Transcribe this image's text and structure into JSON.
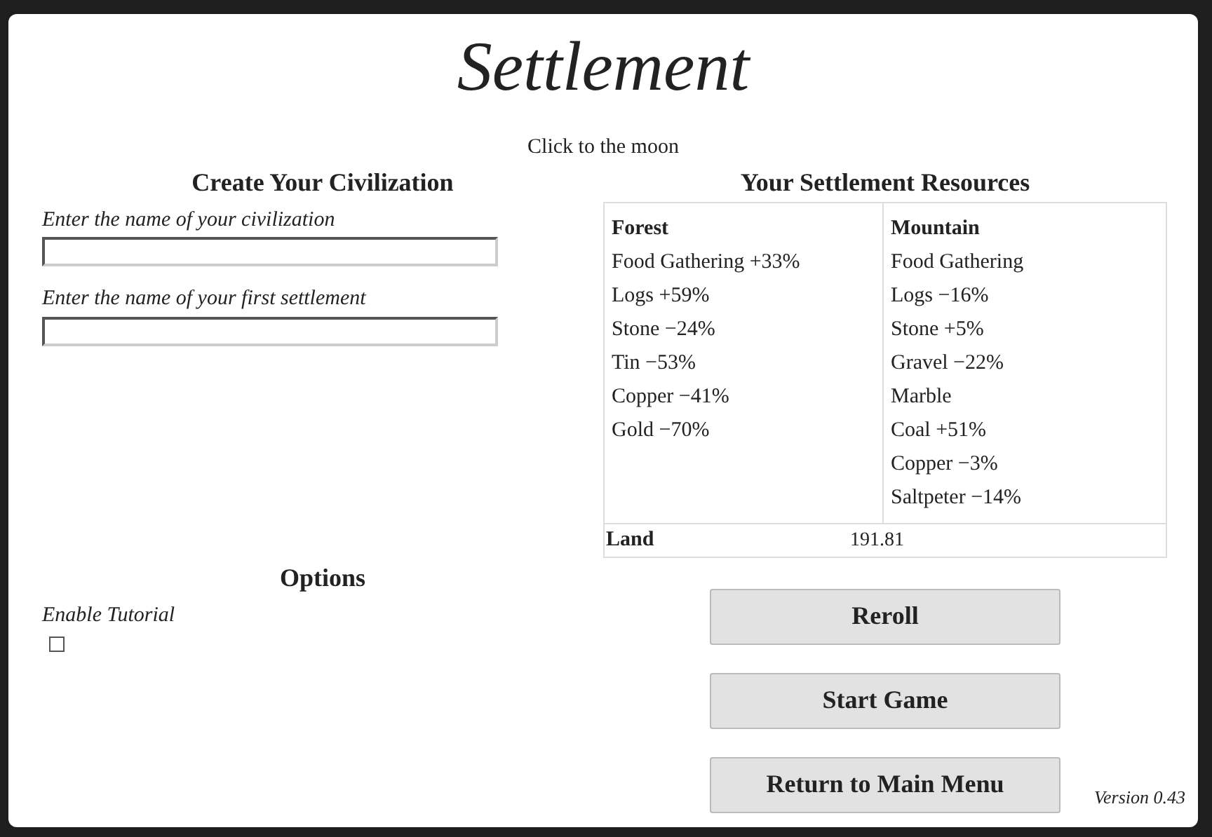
{
  "title": "Settlement",
  "subtitle": "Click to the moon",
  "civilization": {
    "heading": "Create Your Civilization",
    "fields": [
      {
        "label": "Enter the name of your civilization"
      },
      {
        "label": "Enter the name of your first settlement"
      }
    ]
  },
  "resources": {
    "heading": "Your Settlement Resources",
    "columns": [
      {
        "name": "Forest",
        "items": [
          "Food Gathering +33%",
          "Logs +59%",
          "Stone −24%",
          "Tin −53%",
          "Copper −41%",
          "Gold −70%"
        ]
      },
      {
        "name": "Mountain",
        "items": [
          "Food Gathering",
          "Logs −16%",
          "Stone +5%",
          "Gravel −22%",
          "Marble",
          "Coal +51%",
          "Copper −3%",
          "Saltpeter −14%"
        ]
      }
    ],
    "land": {
      "label": "Land",
      "value": "191.81"
    }
  },
  "options": {
    "heading": "Options",
    "items": [
      {
        "label": "Enable Tutorial",
        "checked": false
      }
    ]
  },
  "buttons": [
    "Reroll",
    "Start Game",
    "Return to Main Menu"
  ],
  "version": "Version 0.43"
}
